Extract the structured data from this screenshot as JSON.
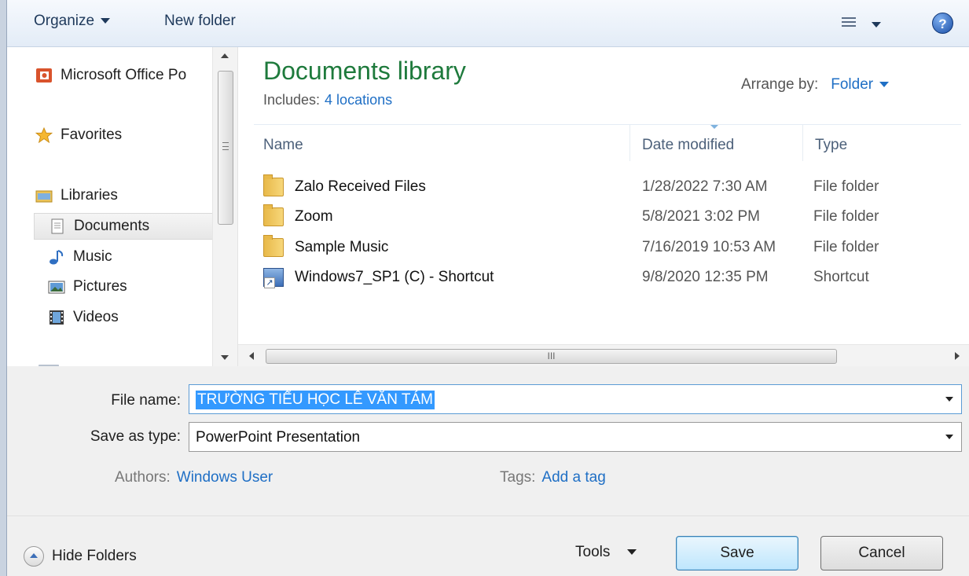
{
  "toolbar": {
    "organize_label": "Organize",
    "new_folder_label": "New folder",
    "help_symbol": "?"
  },
  "nav": {
    "items": [
      {
        "label": "Microsoft Office Po",
        "icon": "office-icon"
      },
      {
        "label": "Favorites",
        "icon": "star-icon"
      },
      {
        "label": "Libraries",
        "icon": "libraries-icon"
      },
      {
        "label": "Documents",
        "icon": "document-icon",
        "selected": true
      },
      {
        "label": "Music",
        "icon": "music-note-icon"
      },
      {
        "label": "Pictures",
        "icon": "picture-icon"
      },
      {
        "label": "Videos",
        "icon": "film-icon"
      }
    ]
  },
  "library": {
    "title": "Documents library",
    "includes_label": "Includes:",
    "includes_link": "4 locations",
    "arrange_label": "Arrange by:",
    "arrange_value": "Folder"
  },
  "columns": {
    "name": "Name",
    "date": "Date modified",
    "type": "Type"
  },
  "files": [
    {
      "name": "Zalo Received Files",
      "date": "1/28/2022 7:30 AM",
      "type": "File folder",
      "icon": "folder-icon"
    },
    {
      "name": "Zoom",
      "date": "5/8/2021 3:02 PM",
      "type": "File folder",
      "icon": "folder-icon"
    },
    {
      "name": "Sample Music",
      "date": "7/16/2019 10:53 AM",
      "type": "File folder",
      "icon": "folder-icon"
    },
    {
      "name": "Windows7_SP1 (C) - Shortcut",
      "date": "9/8/2020 12:35 PM",
      "type": "Shortcut",
      "icon": "shortcut-icon"
    }
  ],
  "hscroll_grip": "III",
  "form": {
    "file_name_label": "File name:",
    "file_name_value": "TRƯỜNG TIỂU HỌC LÊ VĂN TÁM",
    "save_type_label": "Save as type:",
    "save_type_value": "PowerPoint Presentation",
    "authors_label": "Authors:",
    "authors_value": "Windows User",
    "tags_label": "Tags:",
    "tags_value": "Add a tag"
  },
  "footer": {
    "hide_folders_label": "Hide Folders",
    "tools_label": "Tools",
    "save_label": "Save",
    "cancel_label": "Cancel"
  }
}
